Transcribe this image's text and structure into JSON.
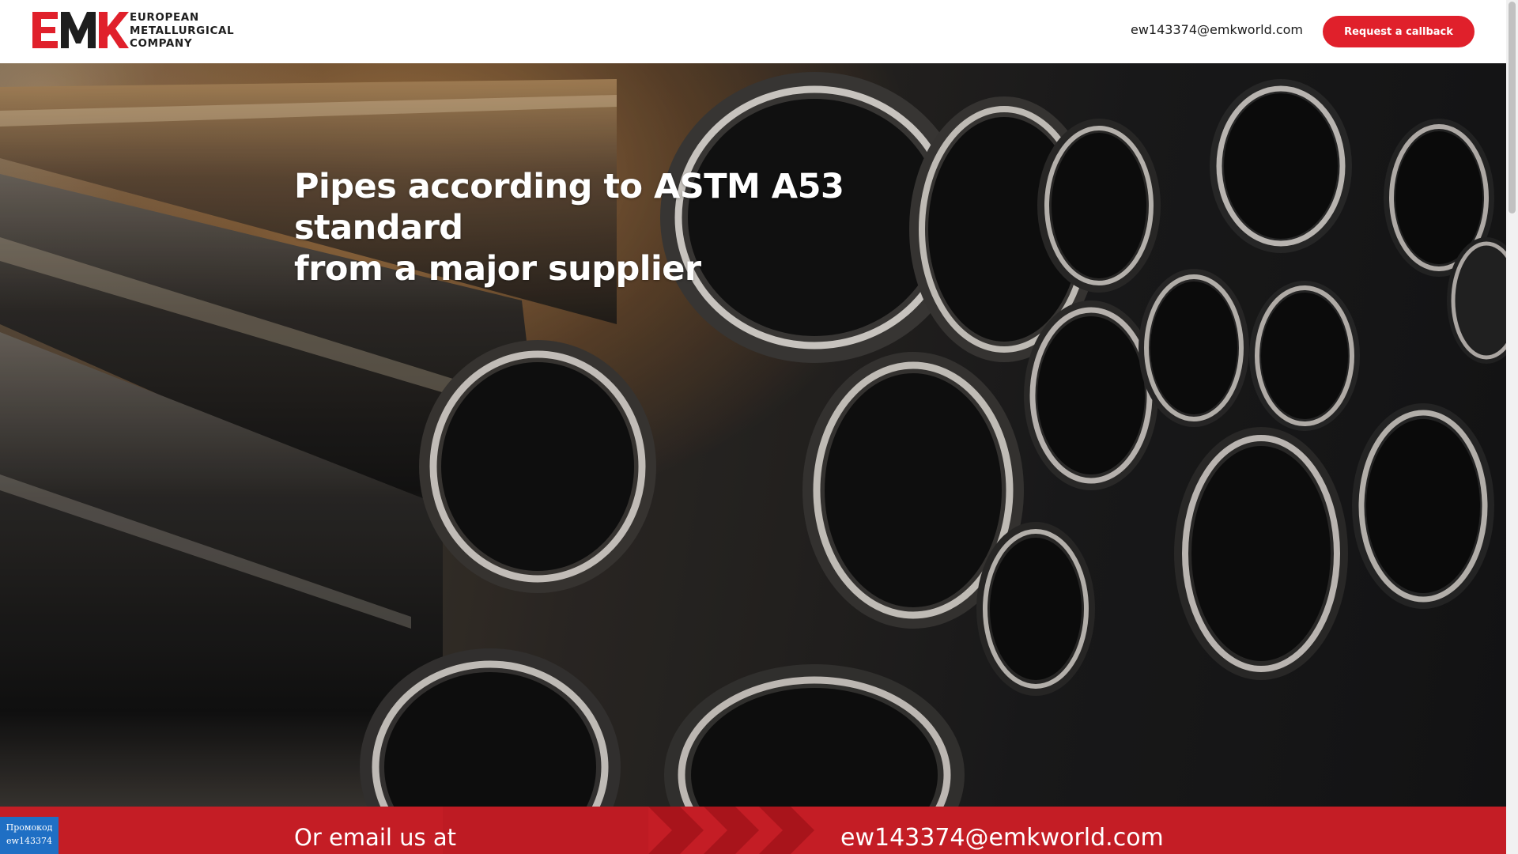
{
  "header": {
    "logo": {
      "mark": "EMK",
      "lines": [
        "EUROPEAN",
        "METALLURGICAL",
        "COMPANY"
      ]
    },
    "email": "ew143374@emkworld.com",
    "callback_button": "Request a callback"
  },
  "hero": {
    "title_line1": "Pipes according to ASTM A53 standard",
    "title_line2": "from a major supplier"
  },
  "cta_band": {
    "label": "Or email us at",
    "email": "ew143374@emkworld.com"
  },
  "promo": {
    "line1": "Промокод",
    "line2": "ew143374"
  },
  "colors": {
    "brand_red": "#e0202b",
    "band_red": "#c41d25",
    "promo_blue": "#1f6fc4"
  }
}
